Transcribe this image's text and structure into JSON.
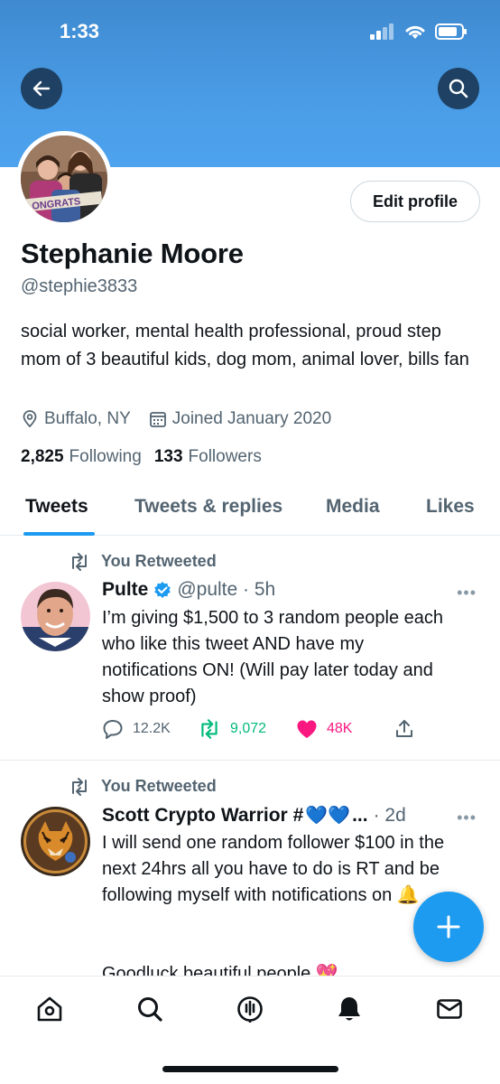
{
  "status_bar": {
    "time": "1:33"
  },
  "profile": {
    "name": "Stephanie Moore",
    "handle": "@stephie3833",
    "bio": "social worker, mental health professional, proud step mom of 3 beautiful kids, dog mom, animal lover, bills fan",
    "location": "Buffalo, NY",
    "joined": "Joined January 2020",
    "following_count": "2,825",
    "following_label": "Following",
    "followers_count": "133",
    "followers_label": "Followers",
    "edit_button": "Edit profile",
    "avatar_caption": "ONGRATS"
  },
  "tabs": [
    {
      "label": "Tweets",
      "active": true
    },
    {
      "label": "Tweets & replies",
      "active": false
    },
    {
      "label": "Media",
      "active": false
    },
    {
      "label": "Likes",
      "active": false
    }
  ],
  "tweets": [
    {
      "retweet_label": "You Retweeted",
      "name": "Pulte",
      "verified": true,
      "handle_time": "@pulte · 5h",
      "text": "I’m giving $1,500 to 3 random people each who like this tweet AND have my notifications ON! (Will pay later today and show proof)",
      "replies": "12.2K",
      "retweets": "9,072",
      "likes": "48K",
      "more": "•••"
    },
    {
      "retweet_label": "You Retweeted",
      "name": "Scott Crypto Warrior #",
      "emoji_hearts": "💙💙",
      "ellipsis": "...",
      "handle_time": "· 2d",
      "text": "I will send one random follower $100 in the next 24hrs all you have to do is RT and be following myself with notifications on 🔔",
      "text_2": "Goodluck beautiful people 💖",
      "more": "•••"
    }
  ],
  "colors": {
    "accent": "#1d9bf0",
    "retweet_green": "#00ba7c",
    "like_pink": "#f91880",
    "secondary_text": "#536471"
  },
  "icons": [
    "back-arrow-icon",
    "search-icon",
    "location-icon",
    "calendar-icon",
    "retweet-icon",
    "verified-icon",
    "reply-icon",
    "heart-icon",
    "share-icon",
    "compose-plus-icon",
    "home-icon",
    "explore-search-icon",
    "spaces-icon",
    "notifications-bell-icon",
    "messages-envelope-icon"
  ]
}
